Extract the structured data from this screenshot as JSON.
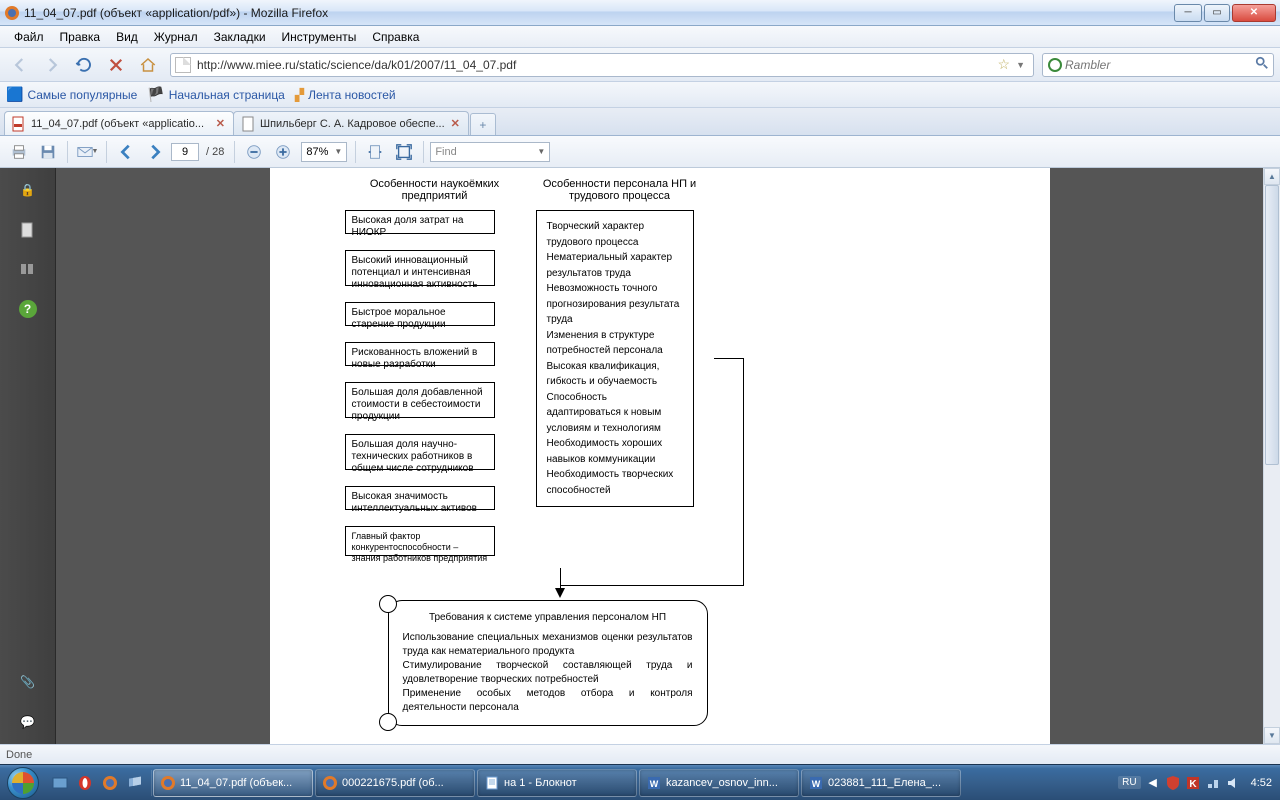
{
  "window": {
    "title": "11_04_07.pdf (объект «application/pdf») - Mozilla Firefox",
    "min": "—",
    "max": "❐",
    "close": "X"
  },
  "menu": {
    "file": "Файл",
    "edit": "Правка",
    "view": "Вид",
    "history": "Журнал",
    "bookmarks": "Закладки",
    "tools": "Инструменты",
    "help": "Справка"
  },
  "nav": {
    "url": "http://www.miee.ru/static/science/da/k01/2007/11_04_07.pdf",
    "search_placeholder": "Rambler"
  },
  "bookmarks": {
    "popular": "Самые популярные",
    "start": "Начальная страница",
    "news": "Лента новостей"
  },
  "tabs": {
    "t1": "11_04_07.pdf (объект «applicatio...",
    "t2": "Шпильберг С. А. Кадровое обеспе..."
  },
  "pdftoolbar": {
    "page": "9",
    "pages": "/  28",
    "zoom": "87%",
    "find": "Find"
  },
  "diagram": {
    "head_left": "Особенности наукоёмких предприятий",
    "head_right": "Особенности персонала  НП и трудового процесса",
    "left": {
      "b1": "Высокая доля затрат на НИОКР",
      "b2": "Высокий инновационный потенциал и интенсивная инновационная активность",
      "b3": "Быстрое моральное старение продукции",
      "b4": "Рискованность вложений в новые разработки",
      "b5": "Большая доля добавленной стоимости в себестоимости продукции",
      "b6": "Большая доля научно-технических работников в общем числе сотрудников",
      "b7": "Высокая значимость интеллектуальных активов",
      "b8": "Главный фактор конкурентоспособности – знания работников предприятия"
    },
    "right_body": "Творческий характер трудового процесса\nНематериальный характер результатов труда\nНевозможность точного прогнозирования результата труда\nИзменения в структуре потребностей персонала\nВысокая квалификация, гибкость и обучаемость\nСпособность адаптироваться к новым условиям и технологиям\nНеобходимость хороших навыков коммуникации\nНеобходимость творческих способностей",
    "bottom_title": "Требования к системе управления персоналом НП",
    "bottom_body": "Использование   специальных   механизмов   оценки результатов труда как нематериального продукта\nСтимулирование  творческой  составляющей  труда  и удовлетворение творческих потребностей\nПрименение особых методов отбора и     контроля деятельности персонала"
  },
  "status": {
    "text": "Done"
  },
  "taskbar": {
    "t1": "11_04_07.pdf (объек...",
    "t2": "000221675.pdf (об...",
    "t3": "на 1 - Блокнот",
    "t4": "kazancev_osnov_inn...",
    "t5": "023881_111_Елена_...",
    "lang": "RU",
    "time": "4:52"
  }
}
